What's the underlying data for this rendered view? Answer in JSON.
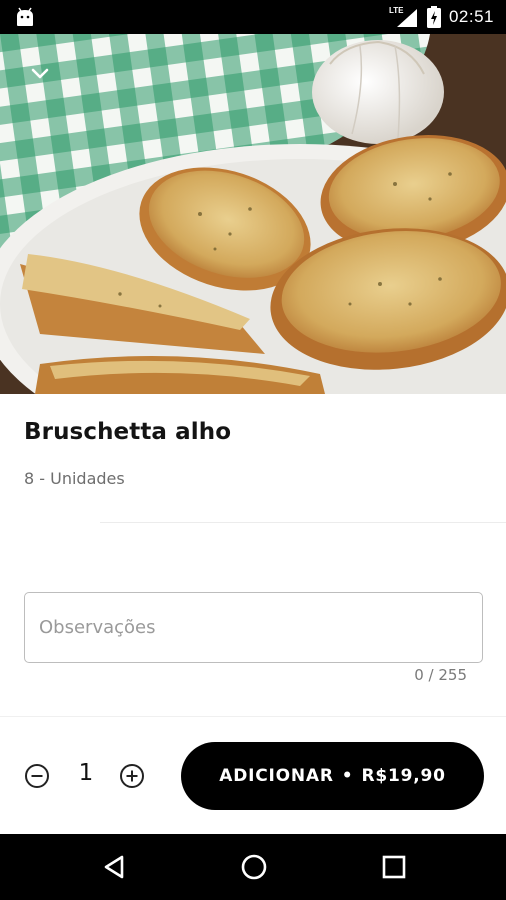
{
  "status_bar": {
    "network": "LTE",
    "time": "02:51"
  },
  "product": {
    "name": "Bruschetta alho",
    "description": "8 - Unidades"
  },
  "observations": {
    "placeholder": "Observações",
    "value": "",
    "counter": "0 / 255"
  },
  "quantity": {
    "value": "1"
  },
  "add_button": {
    "label": "ADICIONAR",
    "separator": "•",
    "price": "R$19,90"
  },
  "colors": {
    "button_background": "#000000",
    "button_text": "#ffffff",
    "title_text": "#141414",
    "secondary_text": "#6e6e6e"
  },
  "icons": {
    "app": "android-icon",
    "collapse": "chevron-down-icon",
    "minus": "minus-circle-icon",
    "plus": "plus-circle-icon",
    "nav_back": "back-triangle-icon",
    "nav_home": "home-circle-icon",
    "nav_recent": "recent-square-icon"
  }
}
